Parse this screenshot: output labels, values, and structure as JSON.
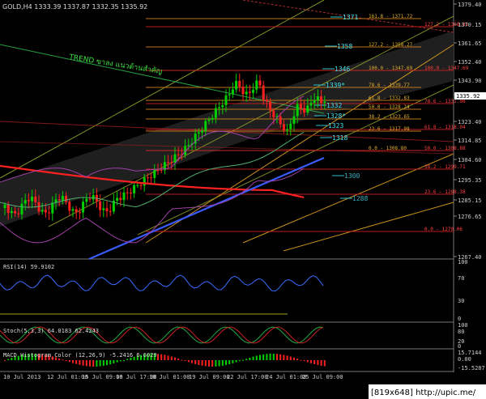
{
  "header": {
    "symbol_line": "GOLD,H4  1333.39 1337.87 1332.35 1335.92"
  },
  "trend_label": "TREND ขาลง แนวต้านสำคัญ",
  "level_labels": [
    "1371",
    "1358",
    "1346",
    "1339*",
    "1332",
    "1328*",
    "1323",
    "1318",
    "1300",
    "1288"
  ],
  "fib_right": [
    {
      "text": "161.8 - 1371.72",
      "color": "#e0b030"
    },
    {
      "text": "127.2 - 1358.27",
      "color": "#e0b030"
    },
    {
      "text": "100.0 - 1347.69",
      "color": "#e0b030"
    },
    {
      "text": "78.6 - 1339.77",
      "color": "#e0b030"
    },
    {
      "text": "61.8 - 1332.83",
      "color": "#e0b030"
    },
    {
      "text": "50.0 - 1328.24",
      "color": "#e0b030"
    },
    {
      "text": "38.2 - 1323.65",
      "color": "#e0b030"
    },
    {
      "text": "23.6 - 1317.98",
      "color": "#e0b030"
    },
    {
      "text": "0.0 - 1308.80",
      "color": "#e0b030"
    }
  ],
  "fib_far": [
    {
      "text": "127.2 - 1368.81",
      "color": "#ff4040"
    },
    {
      "text": "100.0 - 1347.69",
      "color": "#ff4040"
    },
    {
      "text": "78.6 - 1331.08",
      "color": "#ff4040"
    },
    {
      "text": "61.8 - 1318.04",
      "color": "#ff4040"
    },
    {
      "text": "50.0 - 1308.88",
      "color": "#ff4040"
    },
    {
      "text": "38.2 - 1299.71",
      "color": "#ff4040"
    },
    {
      "text": "23.6 - 1288.38",
      "color": "#ff4040"
    },
    {
      "text": "0.0 - 1270.06",
      "color": "#ff4040"
    }
  ],
  "price_axis": [
    "1379.40",
    "1370.15",
    "1361.65",
    "1352.40",
    "1343.90",
    "1335.92",
    "1323.40",
    "1314.85",
    "1304.60",
    "1295.35",
    "1285.15",
    "1276.65",
    "1267.40"
  ],
  "rsi": {
    "label": "RSI(14) 59.9102",
    "axis": [
      "100",
      "70",
      "30",
      "0"
    ]
  },
  "stoch": {
    "label": "Stoch(5,3,3) 64.0183 62.4243",
    "axis": [
      "100",
      "80",
      "20",
      "0"
    ]
  },
  "macd": {
    "label": "MACD Histogram_Color (12,26,9) -5.2416 6.6029",
    "axis": [
      "15.7144",
      "0.00",
      "-15.5287"
    ]
  },
  "time_axis": [
    "10 Jul 2013",
    "12 Jul 01:00",
    "15 Jul 09:00",
    "16 Jul 17:00",
    "18 Jul 01:00",
    "19 Jul 09:00",
    "22 Jul 17:00",
    "24 Jul 01:00",
    "25 Jul 09:00"
  ],
  "watermark": "[819x648] http://upic.me/",
  "colors": {
    "up": "#00d000",
    "down": "#ff2020",
    "ma_red": "#ff2020",
    "ma_blue": "#3a5cff",
    "band": "#9a3aa0"
  }
}
